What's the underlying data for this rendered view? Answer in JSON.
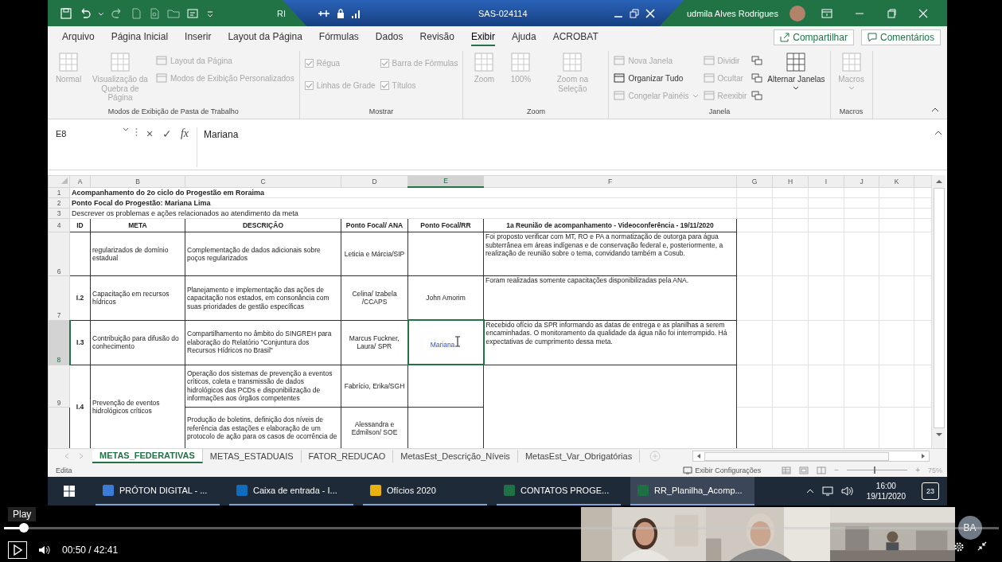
{
  "title_bar": {
    "document": "RI",
    "remote_session": "SAS-024114",
    "user": "udmila Alves Rodrigues"
  },
  "menu_tabs": [
    {
      "label": "Arquivo",
      "selected": false
    },
    {
      "label": "Página Inicial",
      "selected": false
    },
    {
      "label": "Inserir",
      "selected": false
    },
    {
      "label": "Layout da Página",
      "selected": false
    },
    {
      "label": "Fórmulas",
      "selected": false
    },
    {
      "label": "Dados",
      "selected": false
    },
    {
      "label": "Revisão",
      "selected": false
    },
    {
      "label": "Exibir",
      "selected": true
    },
    {
      "label": "Ajuda",
      "selected": false
    },
    {
      "label": "ACROBAT",
      "selected": false
    }
  ],
  "share_button": "Compartilhar",
  "comments_button": "Comentários",
  "ribbon": [
    {
      "label": "Modos de Exibição de Pasta de Trabalho",
      "items": [
        {
          "kind": "big",
          "label": "Normal",
          "disabled": true
        },
        {
          "kind": "big",
          "label": "Visualização da Quebra de Página",
          "disabled": true
        },
        {
          "kind": "small",
          "label": "Layout da Página",
          "disabled": true
        },
        {
          "kind": "small",
          "label": "Modos de Exibição Personalizados",
          "disabled": true
        }
      ]
    },
    {
      "label": "Mostrar",
      "items": [
        {
          "kind": "check",
          "label": "Régua",
          "checked": true,
          "disabled": true
        },
        {
          "kind": "check",
          "label": "Linhas de Grade",
          "checked": true,
          "disabled": true
        },
        {
          "kind": "check",
          "label": "Barra de Fórmulas",
          "checked": true,
          "disabled": true
        },
        {
          "kind": "check",
          "label": "Títulos",
          "checked": true,
          "disabled": true
        }
      ]
    },
    {
      "label": "Zoom",
      "items": [
        {
          "kind": "big",
          "label": "Zoom",
          "disabled": true
        },
        {
          "kind": "big",
          "label": "100%",
          "disabled": true
        },
        {
          "kind": "big",
          "label": "Zoom na Seleção",
          "disabled": true
        }
      ]
    },
    {
      "label": "Janela",
      "items": [
        {
          "kind": "small",
          "label": "Nova Janela",
          "disabled": true
        },
        {
          "kind": "small",
          "label": "Organizar Tudo",
          "disabled": false
        },
        {
          "kind": "small",
          "label": "Congelar Painéis",
          "disabled": true,
          "dropdown": true
        },
        {
          "kind": "small",
          "label": "Dividir",
          "disabled": true
        },
        {
          "kind": "small",
          "label": "Ocultar",
          "disabled": true
        },
        {
          "kind": "small",
          "label": "Reexibir",
          "disabled": true
        },
        {
          "kind": "icon",
          "disabled": false
        },
        {
          "kind": "icon",
          "disabled": false
        },
        {
          "kind": "icon",
          "disabled": false
        },
        {
          "kind": "big",
          "label": "Alternar Janelas",
          "disabled": false,
          "dropdown": true
        }
      ]
    },
    {
      "label": "Macros",
      "items": [
        {
          "kind": "big",
          "label": "Macros",
          "disabled": true,
          "dropdown": true
        }
      ]
    }
  ],
  "formula_bar": {
    "name_box": "E8",
    "cancel": "×",
    "enter": "✓",
    "function_label": "fx",
    "value": "Mariana"
  },
  "sheet": {
    "columns": [
      {
        "label": "A",
        "selected": false
      },
      {
        "label": "B",
        "selected": false
      },
      {
        "label": "C",
        "selected": false
      },
      {
        "label": "D",
        "selected": false
      },
      {
        "label": "E",
        "selected": true
      },
      {
        "label": "F",
        "selected": false
      },
      {
        "label": "G",
        "selected": false
      },
      {
        "label": "H",
        "selected": false
      },
      {
        "label": "I",
        "selected": false
      },
      {
        "label": "J",
        "selected": false
      },
      {
        "label": "K",
        "selected": false
      }
    ],
    "title_rows": [
      {
        "number": "1",
        "text": "Acompanhamento do 2o ciclo do Progestão em Roraima",
        "bold": true
      },
      {
        "number": "2",
        "text": "Ponto Focal do Progestão: Mariana Lima",
        "bold": true
      },
      {
        "number": "3",
        "text": "Descrever os problemas e ações relacionados ao atendimento da meta",
        "bold": false
      }
    ],
    "header": {
      "number": "4",
      "cells": [
        "ID",
        "META",
        "DESCRIÇÃO",
        "Ponto Focal/ ANA",
        "Ponto Focal/RR",
        "1a Reunião de acompanhamento - Videoconferência - 19/11/2020"
      ]
    },
    "rows": [
      {
        "number": "6",
        "selected": false,
        "meta": "regularizados de domínio estadual",
        "reuniao": "Foi proposto verificar com MT, RO e PA a normatização de outorga para água subterrânea em áreas indígenas e de conservação federal e, posteriormente, a realização de reunião sobre o tema, convidando também a Cosub.",
        "parts": [
          {
            "descricao": "Complementação de dados adicionais sobre poços regularizados",
            "ponto_ana": "Leticia e Márcia/SIP"
          }
        ]
      },
      {
        "number": "7",
        "selected": false,
        "id": "I.2",
        "meta": "Capacitação em recursos hídricos",
        "reuniao": "Foram realizadas somente capacitações disponibilizadas pela ANA.",
        "parts": [
          {
            "descricao": "Planejamento e implementação das ações de capacitação nos estados, em consonância com suas prioridades de gestão específicas",
            "ponto_ana": "Celina/ Izabela /CCAPS",
            "ponto_rr": "John Amorim"
          }
        ]
      },
      {
        "number": "8",
        "selected": true,
        "id": "I.3",
        "meta": "Contribuição para difusão do conhecimento",
        "reuniao": "Recebido ofício da SPR informando as datas de entrega e as planilhas a serem encaminhadas. O monitoramento da qualidade da água não foi interrompido. Há expectativas de cumprimento dessa meta.",
        "parts": [
          {
            "descricao": "Compartilhamento no âmbito do SINGREH para elaboração do Relatório \"Conjuntura dos Recursos Hídricos no Brasil\"",
            "ponto_ana": "Marcus Fuckner, Laura/ SPR",
            "ponto_rr": "Mariana"
          }
        ]
      },
      {
        "number": "9",
        "selected": false,
        "id": "I.4",
        "meta": "Prevenção de eventos hidrológicos críticos",
        "parts": [
          {
            "descricao": "Operação dos sistemas de prevenção a eventos críticos, coleta e transmissão de dados hidrológicos das PCDs e disponibilização de informações aos órgãos competentes",
            "ponto_ana": "Fabrício, Erika/SGH"
          },
          {
            "descricao": "Produção de boletins, definição dos níveis de referência das estações e elaboração de um protocolo de ação para os casos de ocorrência de",
            "ponto_ana": "Alessandra e Edmilson/ SOE"
          }
        ]
      }
    ]
  },
  "sheet_tabs": [
    {
      "label": "METAS_FEDERATIVAS",
      "selected": true
    },
    {
      "label": "METAS_ESTADUAIS",
      "selected": false
    },
    {
      "label": "FATOR_REDUCAO",
      "selected": false
    },
    {
      "label": "MetasEst_Descrição_Níveis",
      "selected": false
    },
    {
      "label": "MetasEst_Var_Obrigatórias",
      "selected": false
    }
  ],
  "status_bar": {
    "mode": "Edita",
    "display_settings": "Exibir Configurações",
    "zoom_out": "−",
    "zoom_in": "+",
    "zoom": "75%",
    "zoom_slider": {
      "level": 0.45
    }
  },
  "taskbar": {
    "items": [
      {
        "label": "PRÓTON DIGITAL - ...",
        "selected": false
      },
      {
        "label": "Caixa de entrada - I...",
        "selected": false
      },
      {
        "label": "Ofícios 2020",
        "selected": false
      },
      {
        "label": "CONTATOS PROGE...",
        "selected": false
      },
      {
        "label": "RR_Planilha_Acomp...",
        "selected": true
      }
    ],
    "time": "16:00",
    "date": "19/11/2020",
    "notifications": "23"
  },
  "player": {
    "tooltip": "Play",
    "level": 0.02,
    "time": "00:50 / 42:41",
    "avatar": "BA",
    "video_tiles": [
      {
        "kind": "picture"
      },
      {
        "kind": "picture"
      },
      {
        "kind": "picture"
      }
    ]
  }
}
